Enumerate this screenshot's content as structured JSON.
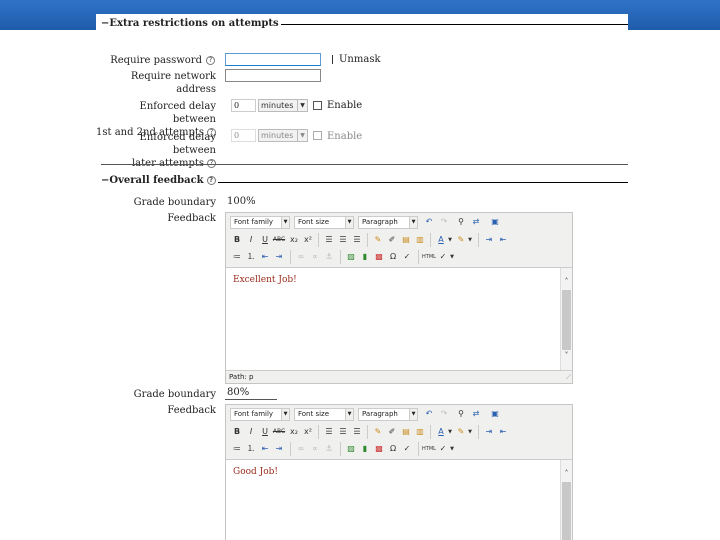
{
  "restrictions": {
    "legend": "Extra restrictions on attempts",
    "require_password_label": "Require password",
    "unmask_label": "Unmask",
    "require_network_label_1": "Require network",
    "require_network_label_2": "address",
    "delay1_label_1": "Enforced delay between",
    "delay1_label_2": "1st and 2nd attempts",
    "delay1_value": "0",
    "delay1_unit": "minutes",
    "delay1_enable": "Enable",
    "delay2_label_1": "Enforced delay between",
    "delay2_label_2": "later attempts",
    "delay2_value": "0",
    "delay2_unit": "minutes",
    "delay2_enable": "Enable"
  },
  "feedback": {
    "legend": "Overall feedback",
    "boundary_label": "Grade boundary",
    "feedback_label": "Feedback",
    "boundary1_value": "100%",
    "boundary2_value": "80%",
    "editor1_content": "Excellent Job!",
    "editor2_content": "Good Job!",
    "path_text": "Path: p"
  },
  "toolbar": {
    "font_family": "Font family",
    "font_size": "Font size",
    "format": "Paragraph",
    "bold": "B",
    "italic": "I",
    "underline": "U",
    "strike": "ABC",
    "sub": "x₂",
    "sup": "x²",
    "text_color": "A",
    "special_char": "Ω",
    "html": "HTML"
  },
  "icons": [
    "help-icon",
    "undo-icon",
    "redo-icon",
    "find-icon",
    "replace-icon",
    "fullscreen-icon",
    "align-left-icon",
    "align-center-icon",
    "align-right-icon",
    "cleanup-icon",
    "paste-icon",
    "text-color-icon",
    "highlight-icon",
    "ltr-icon",
    "rtl-icon",
    "bullet-list-icon",
    "numbered-list-icon",
    "outdent-icon",
    "indent-icon",
    "link-icon",
    "unlink-icon",
    "image-icon",
    "media-icon",
    "emoticon-icon",
    "special-char-icon",
    "spellcheck-icon",
    "html-icon"
  ],
  "colors": {
    "topbar": "#2f73c8",
    "editor_text": "#9b2c1c",
    "input_focus": "#1d7fd0"
  }
}
